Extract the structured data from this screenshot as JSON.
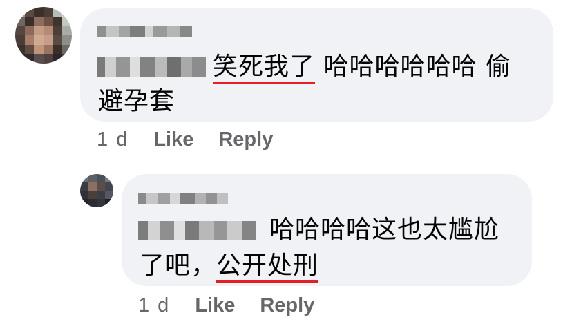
{
  "comments": [
    {
      "text_line1_prefix": "",
      "text_line1_underlined": "笑死我了",
      "text_line1_rest": " 哈哈哈哈哈哈 偷",
      "text_line2": "避孕套",
      "time": "1 d",
      "like_label": "Like",
      "reply_label": "Reply"
    },
    {
      "text_line1": "哈哈哈哈这也太尴尬",
      "text_line2_prefix": "了吧，",
      "text_line2_underlined": "公开处刑",
      "time": "1 d",
      "like_label": "Like",
      "reply_label": "Reply"
    }
  ],
  "colors": {
    "bubble": "#f0f2f5",
    "underline": "#e41e26",
    "meta_text": "#65676b"
  }
}
